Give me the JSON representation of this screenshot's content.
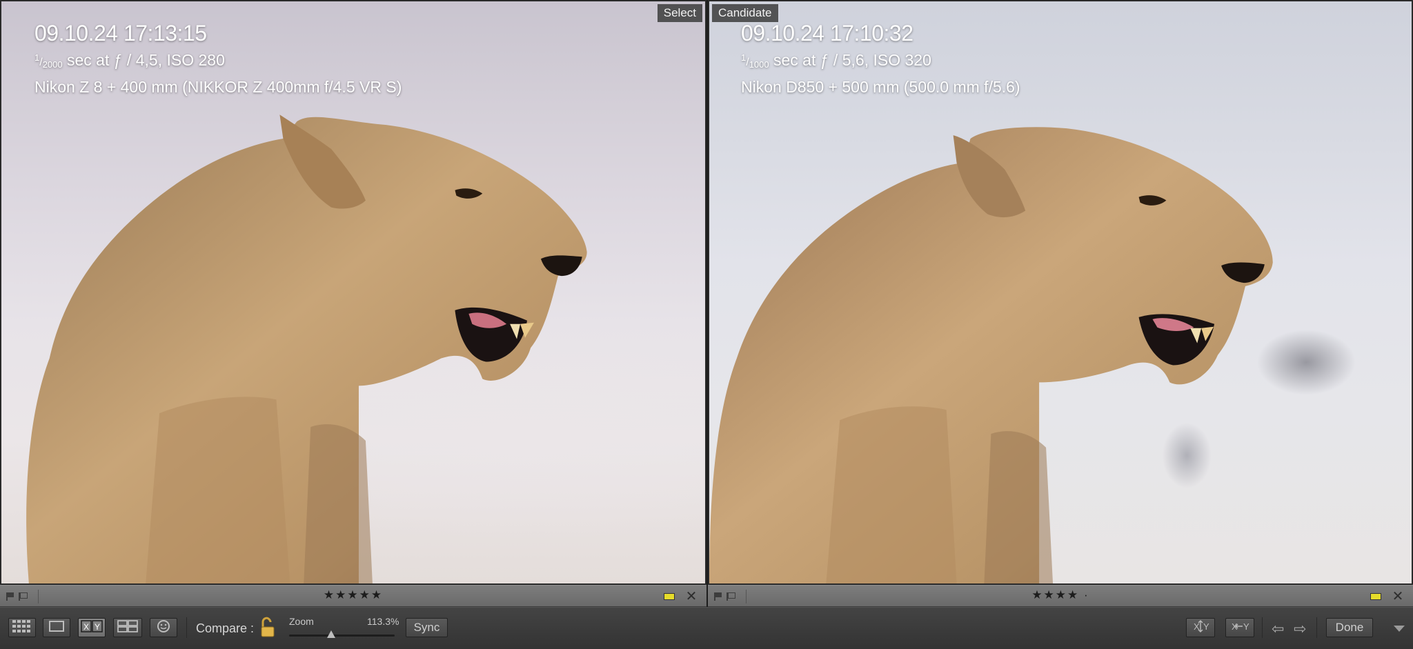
{
  "left_panel": {
    "badge": "Select",
    "timestamp": "09.10.24 17:13:15",
    "shutter_num": "1",
    "shutter_den": "2000",
    "exposure_rest": " sec at ƒ / 4,5, ISO 280",
    "camera": "Nikon Z 8 + 400 mm (NIKKOR Z 400mm f/4.5 VR S)",
    "rating_stars": "★★★★★",
    "rating": 5,
    "color_label": "#e6dc2a"
  },
  "right_panel": {
    "badge": "Candidate",
    "timestamp": "09.10.24 17:10:32",
    "shutter_num": "1",
    "shutter_den": "1000",
    "exposure_rest": " sec at ƒ / 5,6, ISO 320",
    "camera": "Nikon D850 + 500 mm (500.0 mm f/5.6)",
    "rating_stars": "★★★★ ·",
    "rating": 4,
    "color_label": "#e6dc2a"
  },
  "toolbar": {
    "compare_label": "Compare :",
    "zoom_label": "Zoom",
    "zoom_value": "113.3%",
    "zoom_level": 0.4,
    "sync_label": "Sync",
    "done_label": "Done",
    "swap_label": "X Y",
    "make_select_label": "X Y",
    "view_modes": [
      "grid-view-icon",
      "loupe-view-icon",
      "compare-view-icon",
      "survey-view-icon",
      "people-view-icon"
    ],
    "active_view": "compare-view-icon"
  },
  "icons": {
    "flag": "flag-icon",
    "reject_flag": "reject-flag-icon",
    "close": "close-icon",
    "lock": "unlocked-padlock-icon",
    "prev": "arrow-left-icon",
    "next": "arrow-right-icon",
    "menu": "chevron-down-icon"
  }
}
